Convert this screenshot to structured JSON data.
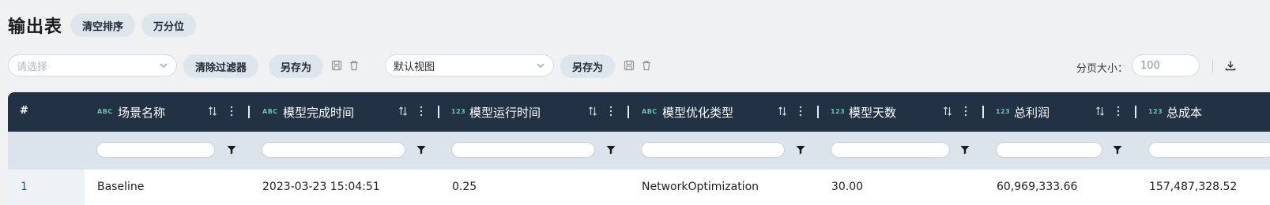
{
  "header": {
    "title": "输出表",
    "buttons": [
      "清空排序",
      "万分位"
    ]
  },
  "toolbar": {
    "filter_select_placeholder": "请选择",
    "clear_filter_label": "清除过滤器",
    "save_as_label": "另存为",
    "view_select_value": "默认视图",
    "view_save_as_label": "另存为",
    "page_size_label": "分页大小：",
    "page_size_value": "100"
  },
  "table": {
    "index_header": "#",
    "columns": [
      {
        "type_tag": "ABC",
        "label": "场景名称"
      },
      {
        "type_tag": "ABC",
        "label": "模型完成时间"
      },
      {
        "type_tag": "123",
        "label": "模型运行时间"
      },
      {
        "type_tag": "ABC",
        "label": "模型优化类型"
      },
      {
        "type_tag": "123",
        "label": "模型天数"
      },
      {
        "type_tag": "123",
        "label": "总利润"
      },
      {
        "type_tag": "123",
        "label": "总成本"
      }
    ],
    "rows": [
      {
        "index": "1",
        "cells": [
          "Baseline",
          "2023-03-23 15:04:51",
          "0.25",
          "NetworkOptimization",
          "30.00",
          "60,969,333.66",
          "157,487,328.52"
        ]
      }
    ]
  },
  "colors": {
    "header_bg": "#223244",
    "filter_row_bg": "#dbe4ec",
    "type_tag": "#5ec7a9",
    "pill_bg": "#dde5ed"
  }
}
